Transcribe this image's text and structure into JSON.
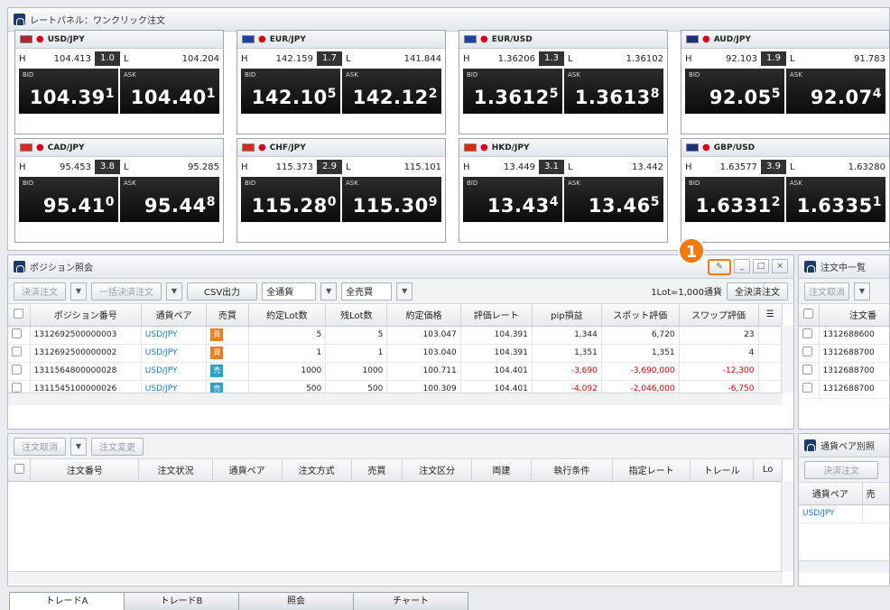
{
  "rate_panel": {
    "title": "レートパネル：ワンクリック注文",
    "tiles": [
      {
        "pair": "USD/JPY",
        "high": "104.413",
        "spread": "1.0",
        "low": "104.204",
        "bid_label": "BID",
        "ask_label": "ASK",
        "bid_main": "104.39",
        "bid_pip": "1",
        "ask_main": "104.40",
        "ask_pip": "1",
        "flag_a": "#b22234",
        "flag_b": "#b22234"
      },
      {
        "pair": "EUR/JPY",
        "high": "142.159",
        "spread": "1.7",
        "low": "141.844",
        "bid_label": "BID",
        "ask_label": "ASK",
        "bid_main": "142.10",
        "bid_pip": "5",
        "ask_main": "142.12",
        "ask_pip": "2",
        "flag_a": "#1f3fa8",
        "flag_b": "#1f3fa8"
      },
      {
        "pair": "EUR/USD",
        "high": "1.36206",
        "spread": "1.3",
        "low": "1.36102",
        "bid_label": "BID",
        "ask_label": "ASK",
        "bid_main": "1.3612",
        "bid_pip": "5",
        "ask_main": "1.3613",
        "ask_pip": "8",
        "flag_a": "#1f3fa8",
        "flag_b": "#b22234"
      },
      {
        "pair": "AUD/JPY",
        "high": "92.103",
        "spread": "1.9",
        "low": "91.783",
        "bid_label": "BID",
        "ask_label": "ASK",
        "bid_main": "92.05",
        "bid_pip": "5",
        "ask_main": "92.07",
        "ask_pip": "4",
        "flag_a": "#1b2f7a",
        "flag_b": "#1b2f7a"
      },
      {
        "pair": "CAD/JPY",
        "high": "95.453",
        "spread": "3.8",
        "low": "95.285",
        "bid_label": "BID",
        "ask_label": "ASK",
        "bid_main": "95.41",
        "bid_pip": "0",
        "ask_main": "95.44",
        "ask_pip": "8",
        "flag_a": "#d52b1e",
        "flag_b": "#d52b1e"
      },
      {
        "pair": "CHF/JPY",
        "high": "115.373",
        "spread": "2.9",
        "low": "115.101",
        "bid_label": "BID",
        "ask_label": "ASK",
        "bid_main": "115.28",
        "bid_pip": "0",
        "ask_main": "115.30",
        "ask_pip": "9",
        "flag_a": "#d52b1e",
        "flag_b": "#d52b1e"
      },
      {
        "pair": "HKD/JPY",
        "high": "13.449",
        "spread": "3.1",
        "low": "13.442",
        "bid_label": "BID",
        "ask_label": "ASK",
        "bid_main": "13.43",
        "bid_pip": "4",
        "ask_main": "13.46",
        "ask_pip": "5",
        "flag_a": "#de2910",
        "flag_b": "#de2910"
      },
      {
        "pair": "GBP/USD",
        "high": "1.63577",
        "spread": "3.9",
        "low": "1.63280",
        "bid_label": "BID",
        "ask_label": "ASK",
        "bid_main": "1.6331",
        "bid_pip": "2",
        "ask_main": "1.6335",
        "ask_pip": "1",
        "flag_a": "#1b2f7a",
        "flag_b": "#b22234"
      }
    ]
  },
  "position_panel": {
    "title": "ポジション照会",
    "settle_btn": "決済注文",
    "bulk_settle_btn": "一括決済注文",
    "csv_btn": "CSV出力",
    "currency_filter": "全通貨",
    "side_filter": "全売買",
    "lot_info": "1Lot=1,000通貨",
    "settle_all_btn": "全決済注文",
    "columns": [
      "ポジション番号",
      "通貨ペア",
      "売買",
      "約定Lot数",
      "残Lot数",
      "約定価格",
      "評価レート",
      "pip損益",
      "スポット評価",
      "スワップ評価"
    ],
    "rows": [
      {
        "id": "1312692500000003",
        "pair": "USD/JPY",
        "side": "買",
        "side_type": "buy",
        "lot": "5",
        "remain": "5",
        "price": "103.047",
        "rate": "104.391",
        "pip": "1,344",
        "spot": "6,720",
        "swap": "23",
        "neg": false
      },
      {
        "id": "1312692500000002",
        "pair": "USD/JPY",
        "side": "買",
        "side_type": "buy",
        "lot": "1",
        "remain": "1",
        "price": "103.040",
        "rate": "104.391",
        "pip": "1,351",
        "spot": "1,351",
        "swap": "4",
        "neg": false
      },
      {
        "id": "1311564800000028",
        "pair": "USD/JPY",
        "side": "売",
        "side_type": "sell",
        "lot": "1000",
        "remain": "1000",
        "price": "100.711",
        "rate": "104.401",
        "pip": "-3,690",
        "spot": "-3,690,000",
        "swap": "-12,300",
        "neg": true
      },
      {
        "id": "1311545100000026",
        "pair": "USD/JPY",
        "side": "売",
        "side_type": "sell",
        "lot": "500",
        "remain": "500",
        "price": "100.309",
        "rate": "104.401",
        "pip": "-4,092",
        "spot": "-2,046,000",
        "swap": "-6,750",
        "neg": true
      }
    ],
    "callout_number": "1"
  },
  "order_panel": {
    "cancel_btn": "注文取消",
    "modify_btn": "注文変更",
    "columns": [
      "注文番号",
      "注文状況",
      "通貨ペア",
      "注文方式",
      "売買",
      "注文区分",
      "両建",
      "執行条件",
      "指定レート",
      "トレール",
      "Lo"
    ]
  },
  "side_orders": {
    "title": "注文中一覧",
    "cancel_btn": "注文取消",
    "column": "注文番",
    "rows": [
      "1312688600",
      "1312688700",
      "1312688700",
      "1312688700"
    ]
  },
  "pair_panel": {
    "title": "通貨ペア別照",
    "settle_btn": "決済注文",
    "col_pair": "通貨ペア",
    "col_side": "売",
    "row_pair": "USD/JPY"
  },
  "tabs": [
    "トレードA",
    "トレードB",
    "照会",
    "チャート"
  ]
}
